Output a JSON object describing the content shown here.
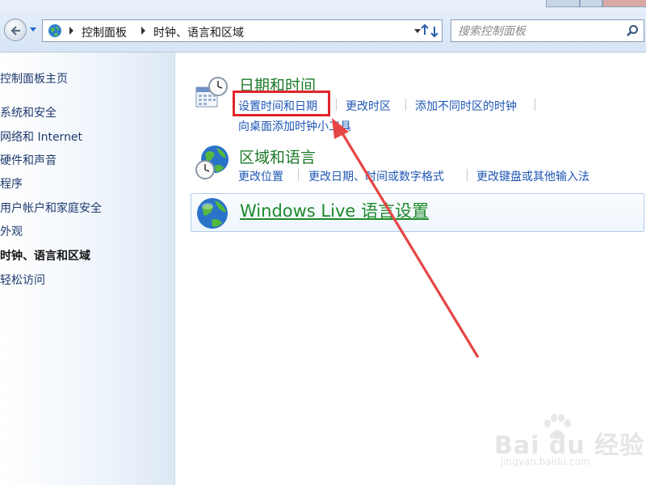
{
  "address_bar": {
    "breadcrumbs": [
      "控制面板",
      "时钟、语言和区域"
    ]
  },
  "search": {
    "placeholder": "搜索控制面板"
  },
  "sidebar": {
    "items": [
      {
        "label": "控制面板主页",
        "current": false
      },
      {
        "label": "系统和安全",
        "current": false
      },
      {
        "label": "网络和 Internet",
        "current": false
      },
      {
        "label": "硬件和声音",
        "current": false
      },
      {
        "label": "程序",
        "current": false
      },
      {
        "label": "用户帐户和家庭安全",
        "current": false
      },
      {
        "label": "外观",
        "current": false
      },
      {
        "label": "时钟、语言和区域",
        "current": true
      },
      {
        "label": "轻松访问",
        "current": false
      }
    ]
  },
  "categories": {
    "datetime": {
      "title": "日期和时间",
      "links": [
        "设置时间和日期",
        "更改时区",
        "添加不同时区的时钟",
        "向桌面添加时钟小工具"
      ],
      "icon": "calendar-clock-icon"
    },
    "region": {
      "title": "区域和语言",
      "links": [
        "更改位置",
        "更改日期、时间或数字格式",
        "更改键盘或其他输入法"
      ],
      "icon": "globe-clock-icon"
    },
    "live": {
      "title": "Windows Live 语言设置",
      "icon": "globe-icon"
    }
  },
  "watermark": {
    "brand": "Bai du 经验",
    "url": "jingyan.baidu.com"
  },
  "colors": {
    "link": "#1f56b5",
    "category_title": "#1d7a2a",
    "highlight": "#e0252b",
    "sidebar_text": "#1e3a6e"
  }
}
